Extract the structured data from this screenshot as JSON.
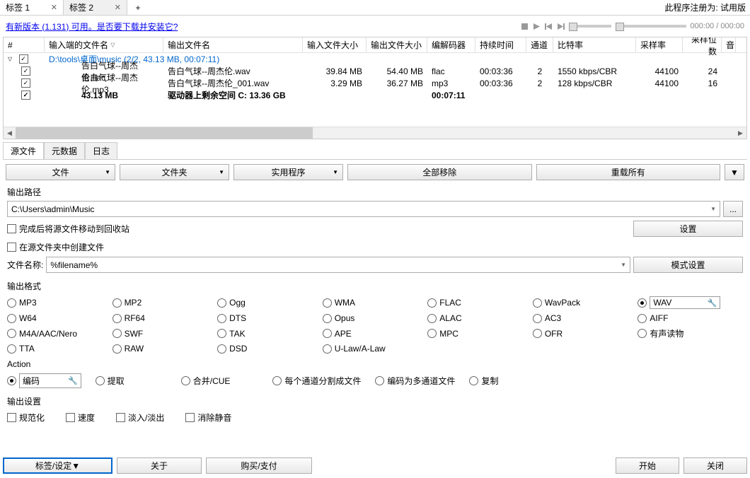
{
  "reg_notice": "此程序注册为: 试用版",
  "tabs": [
    {
      "label": "标签 1",
      "active": true
    },
    {
      "label": "标签 2",
      "active": false
    }
  ],
  "update_link": "有新版本 (1.131) 可用。是否要下载并安装它?",
  "time_display": "000:00 / 000:00",
  "columns": {
    "num": "#",
    "input_file": "输入端的文件名",
    "output_file": "输出文件名",
    "input_size": "输入文件大小",
    "output_size": "输出文件大小",
    "codec": "编解码器",
    "duration": "持续时间",
    "channels": "通道",
    "bitrate": "比特率",
    "sample_rate": "采样率",
    "bit_depth": "采样位数",
    "extra": "音"
  },
  "group_row": "D:\\tools\\桌面\\music (2/2, 43.13 MB, 00:07:11)",
  "rows": [
    {
      "in": "告白气球--周杰伦.flac",
      "out": "告白气球--周杰伦.wav",
      "insz": "39.84 MB",
      "outsz": "54.40 MB",
      "codec": "flac",
      "dur": "00:03:36",
      "ch": "2",
      "br": "1550 kbps/CBR",
      "sr": "44100",
      "bd": "24"
    },
    {
      "in": "告白气球--周杰伦.mp3",
      "out": "告白气球--周杰伦_001.wav",
      "insz": "3.29 MB",
      "outsz": "36.27 MB",
      "codec": "mp3",
      "dur": "00:03:36",
      "ch": "2",
      "br": "128 kbps/CBR",
      "sr": "44100",
      "bd": "16"
    }
  ],
  "total": {
    "size": "43.13 MB",
    "drive": "驱动器上剩余空间 C: 13.36 GB",
    "dur": "00:07:11"
  },
  "subtabs": {
    "source": "源文件",
    "meta": "元数据",
    "log": "日志"
  },
  "buttons": {
    "file": "文件",
    "folder": "文件夹",
    "util": "实用程序",
    "remove_all": "全部移除",
    "reload_all": "重载所有"
  },
  "output_path_label": "输出路径",
  "output_path": "C:\\Users\\admin\\Music",
  "browse": "...",
  "chk_recycle": "完成后将源文件移动到回收站",
  "chk_inplace": "在源文件夹中创建文件",
  "settings_btn": "设置",
  "filename_label": "文件名称:",
  "filename_pattern": "%filename%",
  "mode_settings": "模式设置",
  "output_format_label": "输出格式",
  "formats": [
    "MP3",
    "MP2",
    "Ogg",
    "WMA",
    "FLAC",
    "WavPack",
    "WAV",
    "W64",
    "RF64",
    "DTS",
    "Opus",
    "ALAC",
    "AC3",
    "AIFF",
    "M4A/AAC/Nero",
    "SWF",
    "TAK",
    "APE",
    "MPC",
    "OFR",
    "有声读物",
    "TTA",
    "RAW",
    "DSD",
    "U-Law/A-Law"
  ],
  "selected_format": "WAV",
  "action_label": "Action",
  "actions": {
    "encode": "编码",
    "extract": "提取",
    "merge": "合并/CUE",
    "split": "每个通道分割成文件",
    "multi": "编码为多通道文件",
    "copy": "复制"
  },
  "outset_label": "输出设置",
  "outset": {
    "normalize": "规范化",
    "speed": "速度",
    "fade": "淡入/淡出",
    "silence": "消除静音"
  },
  "bottom": {
    "tabset": "标签/设定",
    "about": "关于",
    "buy": "购买/支付",
    "start": "开始",
    "close": "关闭"
  }
}
